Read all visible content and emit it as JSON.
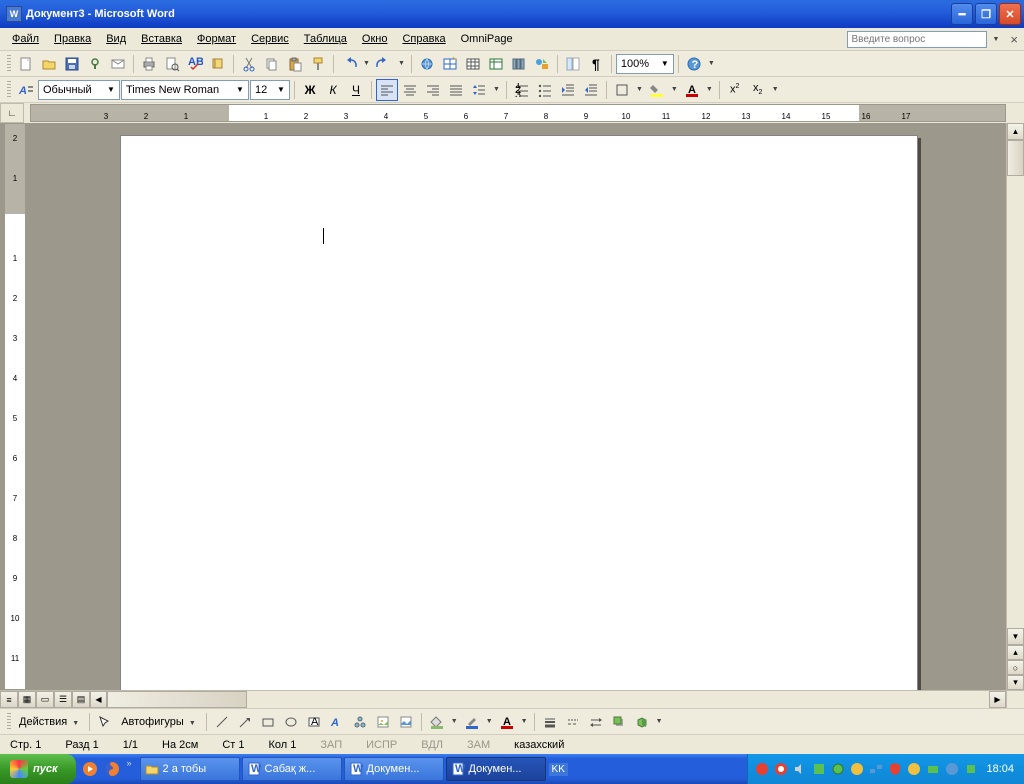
{
  "title": "Документ3 - Microsoft Word",
  "menu": [
    "Файл",
    "Правка",
    "Вид",
    "Вставка",
    "Формат",
    "Сервис",
    "Таблица",
    "Окно",
    "Справка",
    "OmniPage"
  ],
  "helpPlaceholder": "Введите вопрос",
  "formatting": {
    "style": "Обычный",
    "font": "Times New Roman",
    "size": "12"
  },
  "zoom": "100%",
  "drawing": {
    "actions": "Действия",
    "autoshapes": "Автофигуры"
  },
  "status": {
    "page": "Стр. 1",
    "section": "Разд 1",
    "pages": "1/1",
    "at": "На 2см",
    "line": "Ст 1",
    "col": "Кол 1",
    "rec": "ЗАП",
    "trk": "ИСПР",
    "ext": "ВДЛ",
    "ovr": "ЗАМ",
    "lang": "казахский"
  },
  "taskbar": {
    "start": "пуск",
    "buttons": [
      {
        "label": "2 а тобы",
        "icon": "folder"
      },
      {
        "label": "Сабақ ж...",
        "icon": "word"
      },
      {
        "label": "Докумен...",
        "icon": "word"
      },
      {
        "label": "Докумен...",
        "icon": "word",
        "active": true
      }
    ],
    "lang": "KK",
    "clock": "18:04"
  }
}
